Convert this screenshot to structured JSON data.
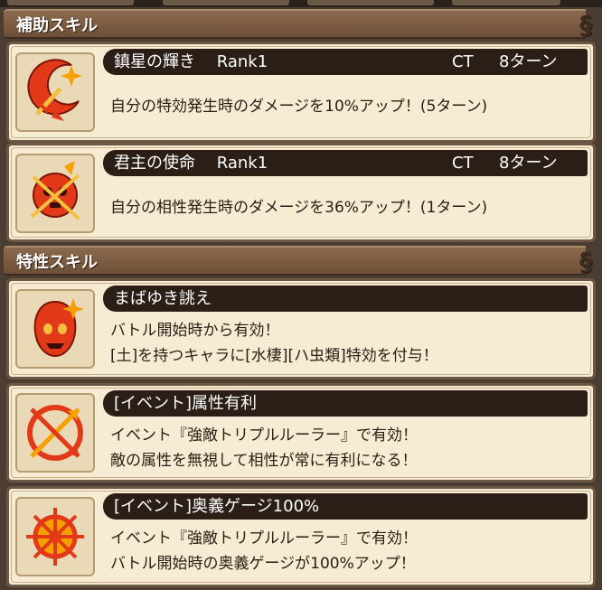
{
  "sections": {
    "support": {
      "header": "補助スキル"
    },
    "trait": {
      "header": "特性スキル"
    }
  },
  "support_skills": [
    {
      "name": "鎮星の輝き",
      "rank": "Rank1",
      "ct_label": "CT",
      "turns": "8ターン",
      "description": "自分の特効発生時のダメージを10%アップ！(5ターン)",
      "icon": "crescent-sword-icon"
    },
    {
      "name": "君主の使命",
      "rank": "Rank1",
      "ct_label": "CT",
      "turns": "8ターン",
      "description": "自分の相性発生時のダメージを36%アップ！(1ターン)",
      "icon": "skull-swords-icon"
    }
  ],
  "trait_skills": [
    {
      "name": "まばゆき誂え",
      "line1": "バトル開始時から有効！",
      "line2": "[土]を持つキャラに[水棲][ハ虫類]特効を付与！",
      "icon": "skull-burst-icon"
    },
    {
      "name": "[イベント]属性有利",
      "line1": "イベント『強敵トリプルルーラー』で有効！",
      "line2": "敵の属性を無視して相性が常に有利になる！",
      "icon": "crossed-arrows-icon"
    },
    {
      "name": "[イベント]奥義ゲージ100%",
      "line1": "イベント『強敵トリプルルーラー』で有効！",
      "line2": "バトル開始時の奥義ゲージが100%アップ！",
      "icon": "compass-star-icon"
    }
  ],
  "colors": {
    "accent_red": "#e23a18",
    "accent_orange": "#f5a000",
    "card_bg": "#f6ebd3",
    "title_bar": "#2a1e16"
  }
}
